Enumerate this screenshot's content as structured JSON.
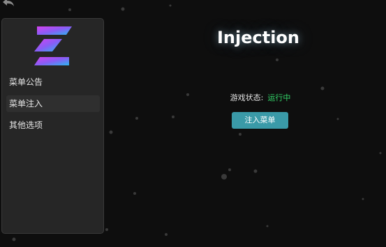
{
  "sidebar": {
    "items": [
      {
        "label": "菜单公告",
        "active": false
      },
      {
        "label": "菜单注入",
        "active": true
      },
      {
        "label": "其他选项",
        "active": false
      }
    ]
  },
  "main": {
    "title": "Injection",
    "status_label": "游戏状态:",
    "status_value": "运行中",
    "inject_button": "注入菜单"
  },
  "colors": {
    "background": "#0e0e0e",
    "panel": "#262626",
    "accent_button": "#3a9aa8",
    "status_running": "#33d96b",
    "logo_gradient_start": "#d642f0",
    "logo_gradient_end": "#2bb6f0"
  },
  "icons": {
    "back": "back-arrow-icon",
    "logo": "app-logo-icon"
  }
}
